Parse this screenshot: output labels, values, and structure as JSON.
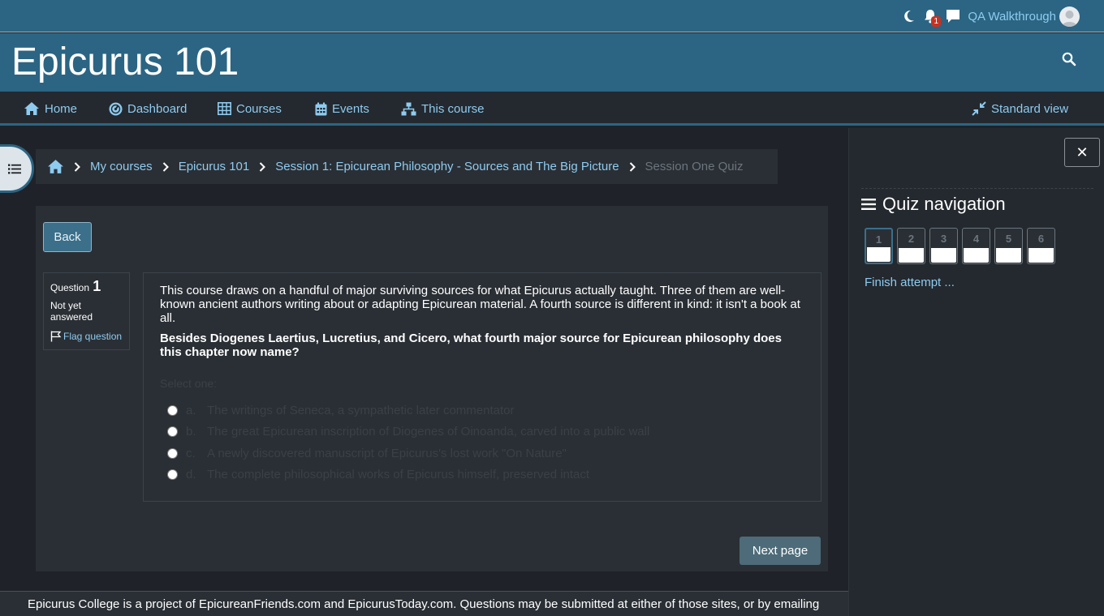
{
  "topbar": {
    "user_name": "QA Walkthrough",
    "notification_count": "1"
  },
  "header": {
    "site_title": "Epicurus 101"
  },
  "nav": {
    "items": [
      {
        "label": "Home",
        "icon": "home-icon"
      },
      {
        "label": "Dashboard",
        "icon": "dashboard-icon"
      },
      {
        "label": "Courses",
        "icon": "courses-icon"
      },
      {
        "label": "Events",
        "icon": "calendar-icon"
      },
      {
        "label": "This course",
        "icon": "sitemap-icon"
      }
    ],
    "standard_view": "Standard view"
  },
  "breadcrumb": {
    "items": [
      "My courses",
      "Epicurus 101",
      "Session 1: Epicurean Philosophy - Sources and The Big Picture"
    ],
    "current": "Session One Quiz"
  },
  "quiz": {
    "back_label": "Back",
    "question_label": "Question",
    "question_number": "1",
    "state": "Not yet answered",
    "flag_label": "Flag question",
    "text": "This course draws on a handful of major surviving sources for what Epicurus actually taught. Three of them are well-known ancient authors writing about or adapting Epicurean material. A fourth source is different in kind: it isn't a book at all.",
    "prompt": "Besides Diogenes Laertius, Lucretius, and Cicero, what fourth major source for Epicurean philosophy does this chapter now name?",
    "select_one": "Select one:",
    "answers": [
      {
        "letter": "a.",
        "text": "The writings of Seneca, a sympathetic later commentator"
      },
      {
        "letter": "b.",
        "text": "The great Epicurean inscription of Diogenes of Oinoanda, carved into a public wall"
      },
      {
        "letter": "c.",
        "text": "A newly discovered manuscript of Epicurus's lost work \"On Nature\""
      },
      {
        "letter": "d.",
        "text": "The complete philosophical works of Epicurus himself, preserved intact"
      }
    ],
    "next_label": "Next page"
  },
  "quiz_nav": {
    "close_label": "✕",
    "title": "Quiz navigation",
    "questions": [
      "1",
      "2",
      "3",
      "4",
      "5",
      "6"
    ],
    "current": "1",
    "finish_label": "Finish attempt ..."
  },
  "footer": {
    "text_1": "Epicurus College is a project of ",
    "link_1": "EpicureanFriends.com",
    "text_2": " and ",
    "link_2": "EpicurusToday.com",
    "text_3": ". Questions may be submitted at either of those sites, or by emailing"
  },
  "colors": {
    "brand": "#2b6583",
    "link": "#8ecbf0",
    "background": "#1f2329",
    "panel": "#2a2f35"
  }
}
